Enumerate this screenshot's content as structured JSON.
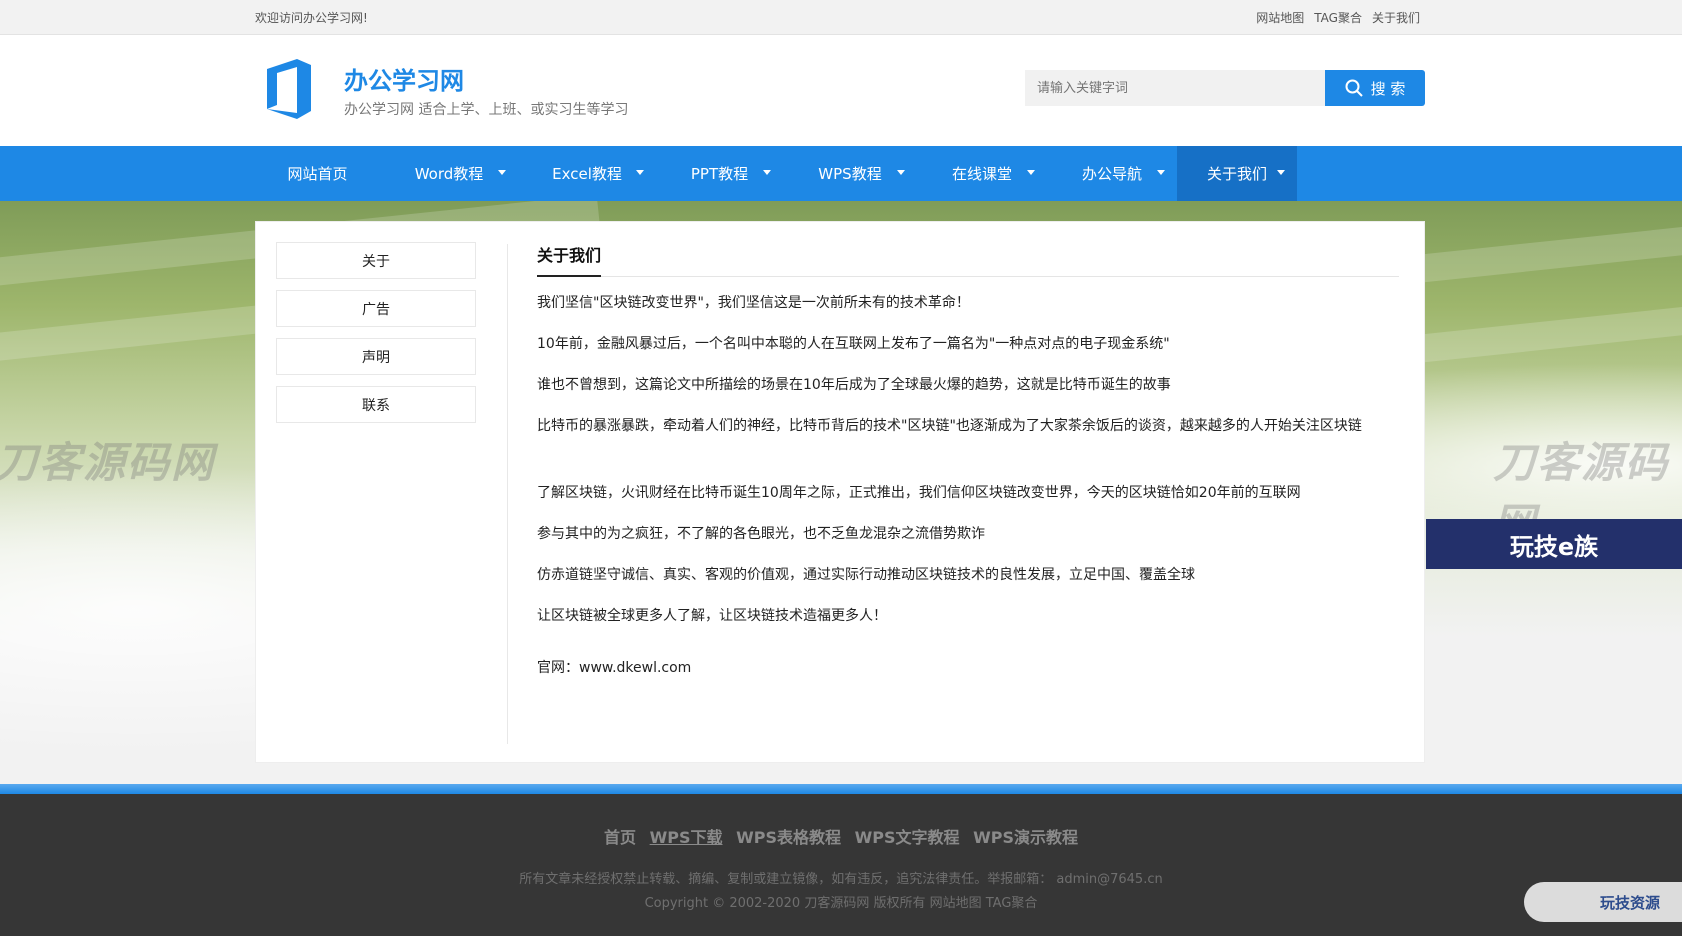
{
  "topbar": {
    "welcome": "欢迎访问办公学习网!",
    "links": [
      "网站地图",
      "TAG聚合",
      "关于我们"
    ]
  },
  "header": {
    "site_name": "办公学习网",
    "site_desc": "办公学习网 适合上学、上班、或实习生等学习",
    "search_placeholder": "请输入关键字词",
    "search_button": "搜 索"
  },
  "nav": {
    "items": [
      {
        "label": "网站首页",
        "dropdown": false
      },
      {
        "label": "Word教程",
        "dropdown": true
      },
      {
        "label": "Excel教程",
        "dropdown": true
      },
      {
        "label": "PPT教程",
        "dropdown": true
      },
      {
        "label": "WPS教程",
        "dropdown": true
      },
      {
        "label": "在线课堂",
        "dropdown": true
      },
      {
        "label": "办公导航",
        "dropdown": true
      },
      {
        "label": "关于我们",
        "dropdown": true,
        "active": true
      }
    ]
  },
  "sidebar": {
    "items": [
      "关于",
      "广告",
      "声明",
      "联系"
    ]
  },
  "article": {
    "title": "关于我们",
    "paragraphs": [
      " 我们坚信\"区块链改变世界\"，我们坚信这是一次前所未有的技术革命！",
      "10年前，金融风暴过后，一个名叫中本聪的人在互联网上发布了一篇名为\"一种点对点的电子现金系统\"",
      "谁也不曾想到，这篇论文中所描绘的场景在10年后成为了全球最火爆的趋势，这就是比特币诞生的故事",
      "比特币的暴涨暴跌，牵动着人们的神经，比特币背后的技术\"区块链\"也逐渐成为了大家茶余饭后的谈资，越来越多的人开始关注区块链",
      "了解区块链，火讯财经在比特币诞生10周年之际，正式推出，我们信仰区块链改变世界，今天的区块链恰如20年前的互联网",
      "参与其中的为之疯狂，不了解的各色眼光，也不乏鱼龙混杂之流借势欺诈",
      "仿赤道链坚守诚信、真实、客观的价值观，通过实际行动推动区块链技术的良性发展，立足中国、覆盖全球",
      "让区块链被全球更多人了解，让区块链技术造福更多人！",
      "官网：www.dkewl.com"
    ]
  },
  "watermark_text": "刀客源码网",
  "side_ad_text": "玩技e族",
  "footer": {
    "links": [
      "首页",
      "WPS下载",
      "WPS表格教程",
      "WPS文字教程",
      "WPS演示教程"
    ],
    "notice": "所有文章未经授权禁止转载、摘编、复制或建立镜像，如有违反，追究法律责任。举报邮箱： admin@7645.cn",
    "copyright": "Copyright © 2002-2020  刀客源码网  版权所有  网站地图  TAG聚合"
  },
  "float_button": "玩技资源",
  "colors": {
    "brand": "#1e88e5",
    "nav_active": "#1670c6",
    "footer_bg": "#363636"
  }
}
